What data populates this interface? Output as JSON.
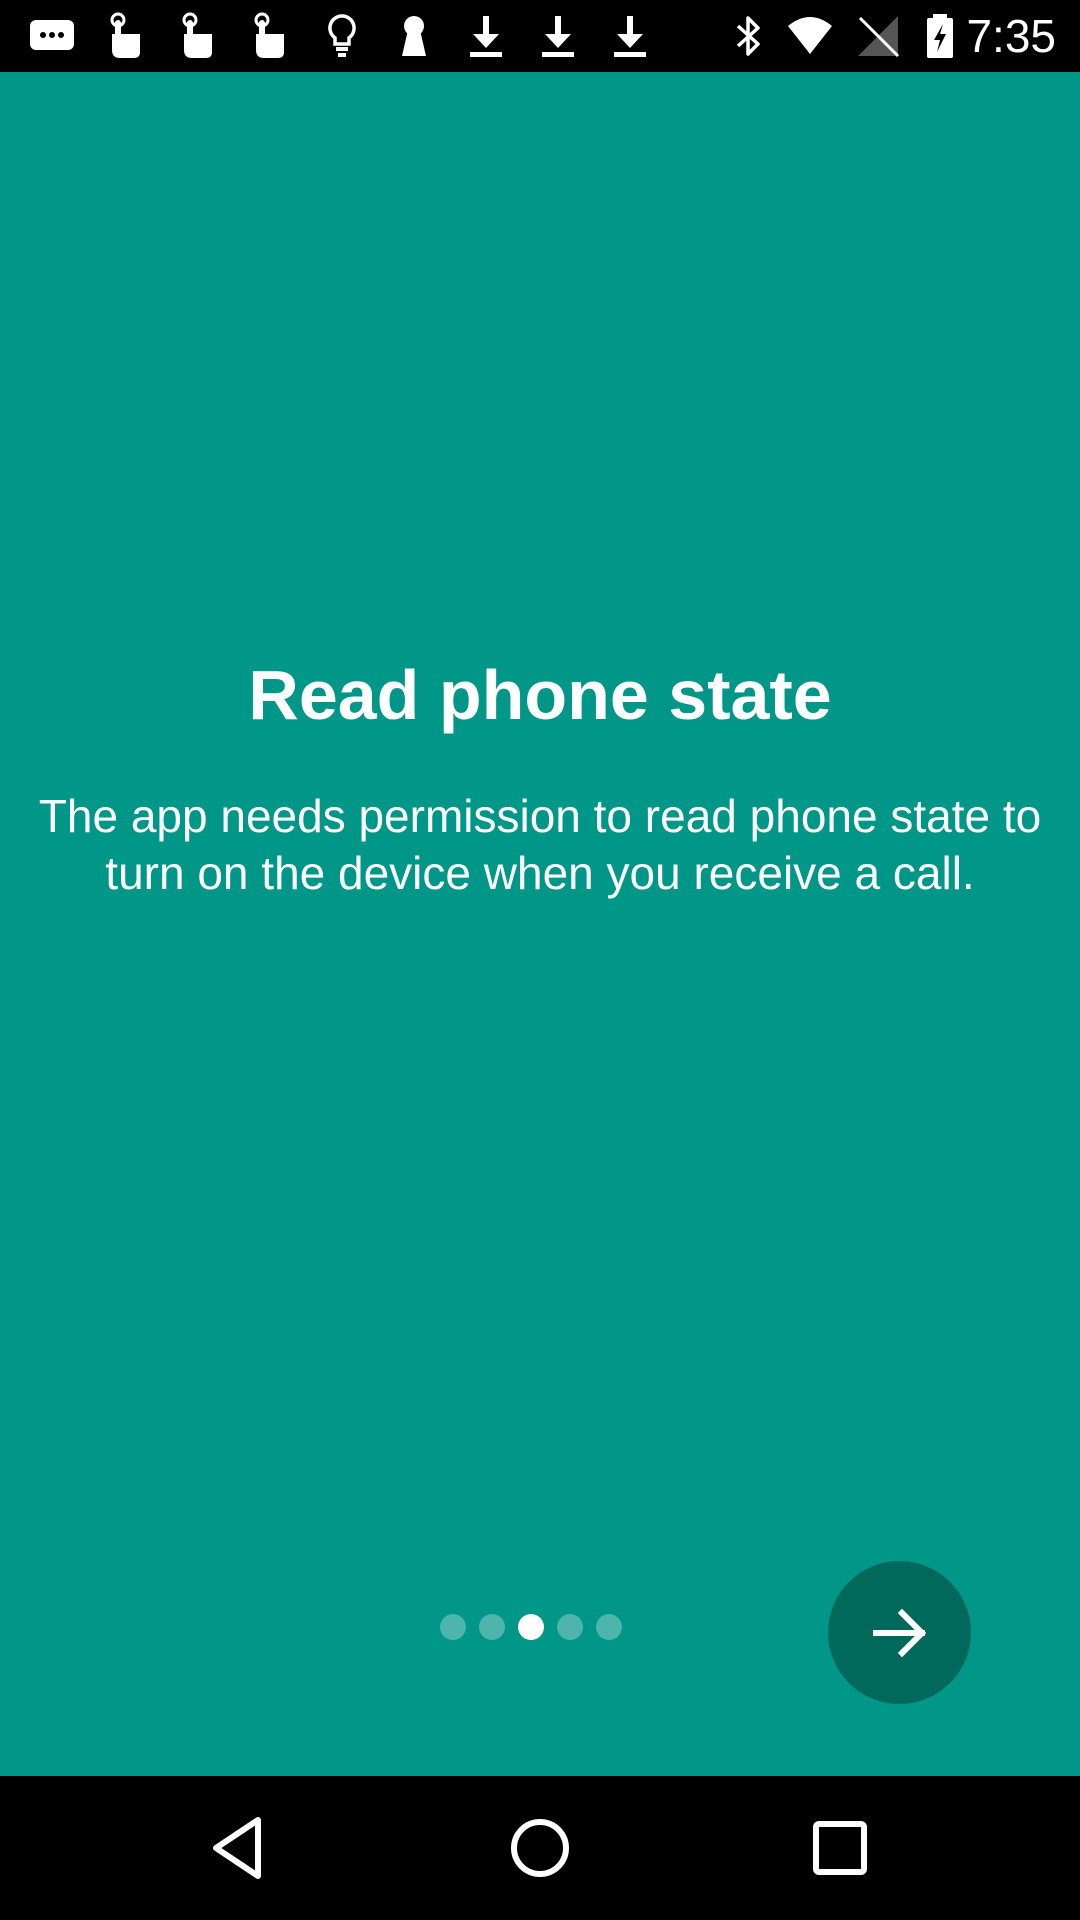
{
  "status_bar": {
    "time": "7:35",
    "icons": [
      "message-icon",
      "hand-touch-icon",
      "hand-touch-icon",
      "hand-touch-icon",
      "lightbulb-icon",
      "keyhole-icon",
      "download-icon",
      "download-icon",
      "download-icon",
      "bluetooth-icon",
      "wifi-icon",
      "no-signal-icon",
      "battery-charging-icon"
    ]
  },
  "page": {
    "title": "Read phone state",
    "description": "The app needs permission to read phone state to turn on the device when you receive a call."
  },
  "pager": {
    "total": 5,
    "current": 3
  },
  "next_button": {
    "icon": "arrow-right-icon"
  },
  "nav_bar": {
    "buttons": [
      "back-icon",
      "home-icon",
      "recents-icon"
    ]
  },
  "colors": {
    "background": "#009688",
    "fab": "#00695c",
    "text": "#ffffff",
    "system_bars": "#000000"
  }
}
